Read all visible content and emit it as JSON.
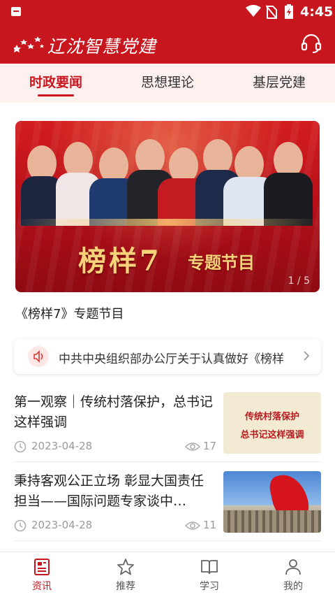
{
  "status_bar": {
    "time": "4:45"
  },
  "header": {
    "app_title": "辽沈智慧党建",
    "support_icon": "headset-icon",
    "accent": "#c8161e"
  },
  "tabs": [
    {
      "label": "时政要闻",
      "active": true
    },
    {
      "label": "思想理论",
      "active": false
    },
    {
      "label": "基层党建",
      "active": false
    }
  ],
  "banner": {
    "title": "榜样",
    "title_number": "7",
    "subtitle": "专题节目",
    "pager": "1 / 5",
    "caption": "《榜样7》专题节目"
  },
  "notice": {
    "text": "中共中央组织部办公厅关于认真做好《榜样",
    "icon": "speaker-icon"
  },
  "news": [
    {
      "title": "第一观察｜传统村落保护，总书记这样强调",
      "date": "2023-04-28",
      "views": "17",
      "thumb_line1": "传统村落保护",
      "thumb_line2": "总书记这样强调"
    },
    {
      "title": "秉持客观公正立场 彰显大国责任担当——国际问题专家谈中…",
      "date": "2023-04-28",
      "views": "11"
    }
  ],
  "bottom_nav": [
    {
      "label": "资讯",
      "icon": "news-icon",
      "active": true
    },
    {
      "label": "推荐",
      "icon": "star-icon",
      "active": false
    },
    {
      "label": "学习",
      "icon": "book-icon",
      "active": false
    },
    {
      "label": "我的",
      "icon": "profile-icon",
      "active": false
    }
  ]
}
